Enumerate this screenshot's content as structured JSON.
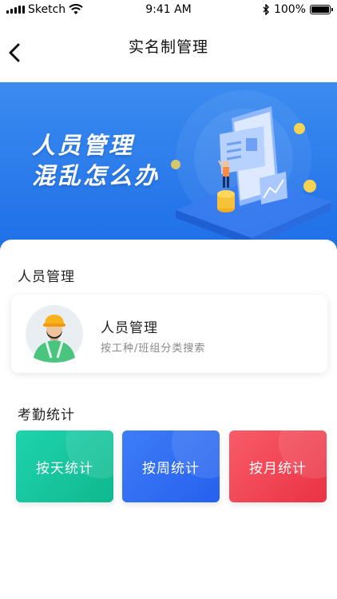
{
  "status_bar": {
    "carrier": "Sketch",
    "time": "9:41 AM",
    "battery": "100%"
  },
  "nav": {
    "title": "实名制管理",
    "back_icon": "chevron-left-icon"
  },
  "banner": {
    "line1": "人员管理",
    "line2": "混乱怎么办"
  },
  "personnel_section": {
    "title": "人员管理",
    "card": {
      "title": "人员管理",
      "subtitle": "按工种/班组分类搜索",
      "avatar_icon": "worker-avatar-icon"
    }
  },
  "attendance_section": {
    "title": "考勤统计",
    "buttons": [
      {
        "label": "按天统计",
        "color": "#17c49c"
      },
      {
        "label": "按周统计",
        "color": "#2f6ef3"
      },
      {
        "label": "按月统计",
        "color": "#f04452"
      }
    ]
  },
  "colors": {
    "banner": "#2a7cec",
    "card_shadow": "#e6e6e6"
  }
}
